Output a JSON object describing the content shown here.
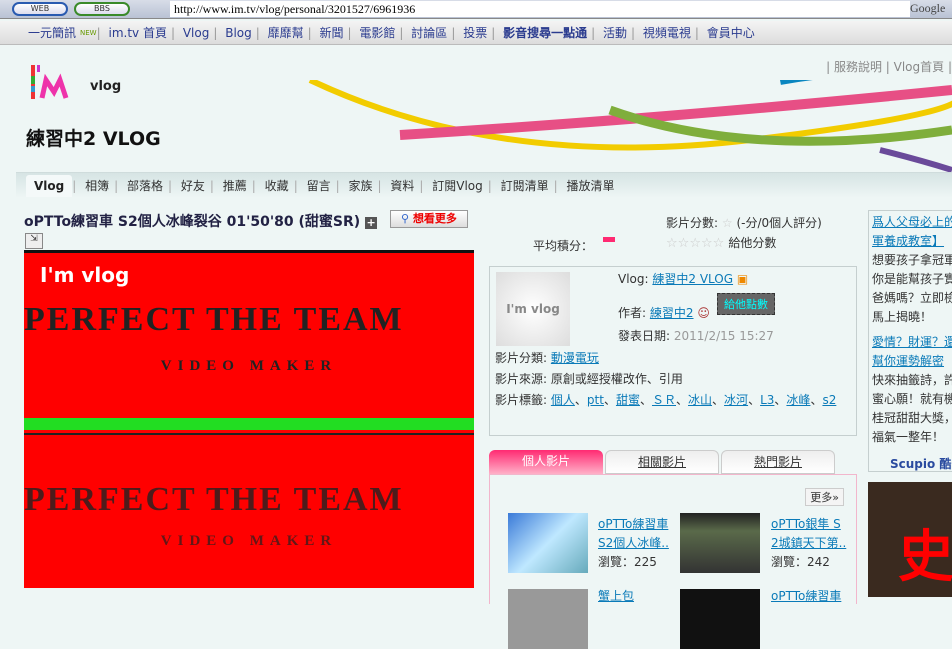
{
  "browser": {
    "web_label": "WEB",
    "bbs_label": "BBS",
    "url": "http://www.im.tv/vlog/personal/3201527/6961936",
    "search_engine": "Google"
  },
  "topnav": {
    "items": [
      "一元簡訊",
      "im.tv 首頁",
      "Vlog",
      "Blog",
      "靡靡幫",
      "新聞",
      "電影館",
      "討論區",
      "投票",
      "影音搜尋一點通",
      "活動",
      "視頻電視",
      "會員中心"
    ],
    "new_badge": "NEW"
  },
  "header": {
    "service_links": [
      "服務說明",
      "Vlog首頁"
    ],
    "logo_text": "I'm vlog",
    "blog_title": "練習中2 VLOG"
  },
  "subnav": {
    "items": [
      "Vlog",
      "相簿",
      "部落格",
      "好友",
      "推薦",
      "收藏",
      "留言",
      "家族",
      "資料",
      "訂閱Vlog",
      "訂閱清單",
      "播放清單"
    ],
    "active": "Vlog"
  },
  "video": {
    "title": "oPTTo練習車 S2個人冰峰裂谷 01'50'80 (甜蜜SR)",
    "more_button": "想看更多",
    "player_logo": "I'm vlog",
    "player_line1": "PERFECT THE TEAM",
    "player_line2": "VIDEO MAKER"
  },
  "rating": {
    "label": "影片分數:",
    "summary": "(-分/0個人評分)",
    "avg_label": "平均積分：",
    "give_label": "給他分數",
    "stars": 0
  },
  "info": {
    "vlog_label": "Vlog:",
    "vlog_name": "練習中2 VLOG",
    "author_label": "作者:",
    "author": "練習中2",
    "tooltip": "給他點數",
    "date_label": "發表日期:",
    "date": "2011/2/15 15:27",
    "category_label": "影片分類:",
    "category": "動漫電玩",
    "source_label": "影片來源:",
    "source": "原創或經授權改作、引用",
    "tags_label": "影片標籤:",
    "tags": [
      "個人",
      "ptt",
      "甜蜜",
      "ＳＲ",
      "冰山",
      "冰河",
      "L3",
      "冰峰",
      "s2"
    ]
  },
  "tabs": {
    "items": [
      "個人影片",
      "相關影片",
      "熱門影片"
    ],
    "active": "個人影片",
    "more": "更多»"
  },
  "videos": [
    {
      "title1": "oPTTo練習車",
      "title2": "S2個人冰峰..",
      "views": "瀏覽：225"
    },
    {
      "title1": "oPTTo銀隼 S",
      "title2": "2城鎮天下第..",
      "views": "瀏覽：242"
    },
    {
      "title1": "蟹上包",
      "title2": "",
      "views": ""
    },
    {
      "title1": "oPTTo練習車",
      "title2": "",
      "views": ""
    }
  ],
  "sidebar": {
    "ad1_title1": "爲人父母必上的",
    "ad1_title2": "軍養成教室】",
    "ad1_body": [
      "想要孩子拿冠軍",
      "你是能幫孩子實",
      "爸媽嗎？立即檢",
      "馬上揭曉！"
    ],
    "ad2_title1": "愛情？財運？還",
    "ad2_title2": "幫你運勢解密",
    "ad2_body": [
      "快來抽籤詩，許",
      "蜜心願！就有機",
      "桂冠甜甜大獎，",
      "福氣一整年！"
    ],
    "brand": "Scupio 酷",
    "banner_text": "史"
  },
  "colors": {
    "accent_pink": "#ff2a72",
    "link": "#0a7ab8",
    "player_red": "#ff0000"
  }
}
